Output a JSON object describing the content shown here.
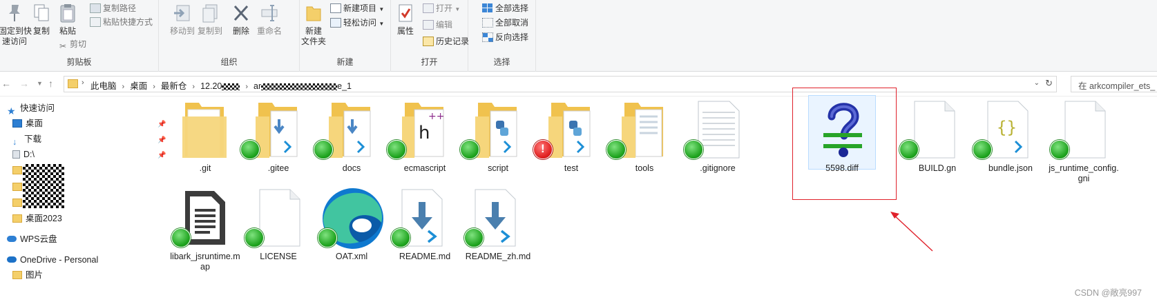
{
  "ribbon": {
    "clipboard": {
      "pin_label": "固定到快\n速访问",
      "copy_label": "复制",
      "paste_label": "粘贴",
      "copy_path_label": "复制路径",
      "paste_shortcut_label": "粘贴快捷方式",
      "cut_label": "剪切",
      "title": "剪贴板"
    },
    "organize": {
      "move_label": "移动到",
      "copy_to_label": "复制到",
      "delete_label": "删除",
      "rename_label": "重命名",
      "title": "组织"
    },
    "new": {
      "new_folder_label": "新建\n文件夹",
      "new_item_label": "新建项目",
      "easy_access_label": "轻松访问",
      "title": "新建"
    },
    "open": {
      "properties_label": "属性",
      "open_label": "打开",
      "edit_label": "编辑",
      "history_label": "历史记录",
      "title": "打开"
    },
    "select": {
      "select_all_label": "全部选择",
      "select_none_label": "全部取消",
      "invert_label": "反向选择",
      "title": "选择"
    }
  },
  "address": {
    "crumbs": [
      "此电脑",
      "桌面",
      "最新仓",
      "12.20",
      "ar",
      "e_1"
    ],
    "search_placeholder": "在 arkcompiler_ets_"
  },
  "nav": {
    "quick_access": "快速访问",
    "desktop": "桌面",
    "downloads": "下载",
    "drive_d": "D:\\",
    "desktop2023": "桌面2023",
    "wps": "WPS云盘",
    "onedrive": "OneDrive - Personal",
    "pictures": "图片"
  },
  "files": [
    {
      "name": ".git",
      "type": "folder",
      "badge": "none"
    },
    {
      "name": ".gitee",
      "type": "folder",
      "badge": "ok"
    },
    {
      "name": "docs",
      "type": "folder",
      "badge": "ok"
    },
    {
      "name": "ecmascript",
      "type": "folder",
      "badge": "ok"
    },
    {
      "name": "script",
      "type": "folder",
      "badge": "ok"
    },
    {
      "name": "test",
      "type": "folder",
      "badge": "error"
    },
    {
      "name": "tools",
      "type": "folder",
      "badge": "ok"
    },
    {
      "name": ".gitignore",
      "type": "text",
      "badge": "ok"
    },
    {
      "name": "5598.diff",
      "type": "diff",
      "badge": "none"
    },
    {
      "name": "BUILD.gn",
      "type": "blank",
      "badge": "ok"
    },
    {
      "name": "bundle.json",
      "type": "json",
      "badge": "ok"
    },
    {
      "name": "js_runtime_config.gni",
      "type": "blank",
      "badge": "ok"
    },
    {
      "name": "libark_jsruntime.map",
      "type": "doc",
      "badge": "ok"
    },
    {
      "name": "LICENSE",
      "type": "blank",
      "badge": "ok"
    },
    {
      "name": "OAT.xml",
      "type": "edge",
      "badge": "ok"
    },
    {
      "name": "README.md",
      "type": "vscode",
      "badge": "ok"
    },
    {
      "name": "README_zh.md",
      "type": "vscode",
      "badge": "ok"
    }
  ],
  "watermark": "CSDN @敞亮997",
  "colors": {
    "annotation_red": "#e0202a",
    "folder_yellow": "#f4cf6a",
    "selection_blue": "#cce8ff",
    "ok_green": "#1ea31e",
    "error_red": "#e02020"
  }
}
